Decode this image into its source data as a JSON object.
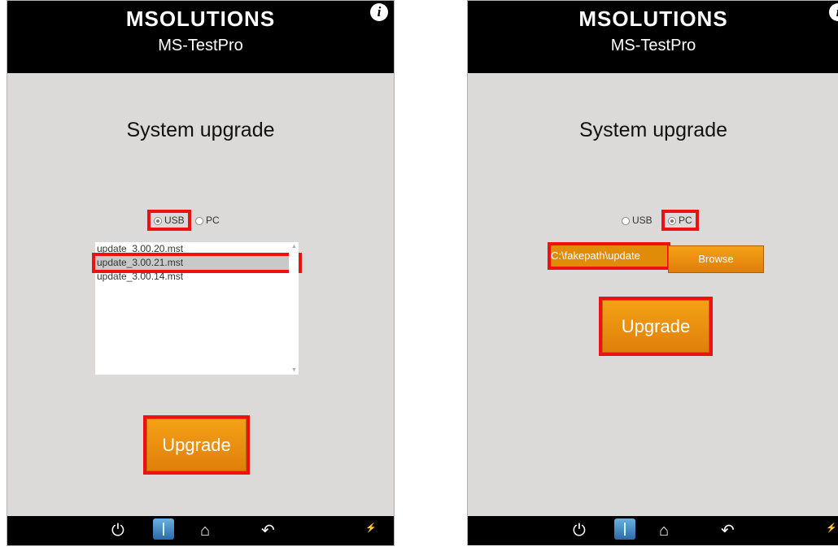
{
  "left": {
    "logo": "MSOLUTIONS",
    "app_title": "MS-TestPro",
    "info_icon": "i",
    "heading": "System upgrade",
    "radio_usb": "USB",
    "radio_pc": "PC",
    "selected_source": "USB",
    "files": [
      "update_3.00.20.mst",
      "update_3.00.21.mst",
      "update_3.00.14.mst"
    ],
    "selected_file": "update_3.00.21.mst",
    "upgrade_label": "Upgrade"
  },
  "right": {
    "logo": "MSOLUTIONS",
    "app_title": "MS-TestPro",
    "info_icon": "i",
    "heading": "System upgrade",
    "radio_usb": "USB",
    "radio_pc": "PC",
    "selected_source": "PC",
    "file_path": "C:\\fakepath\\update",
    "browse_label": "Browse",
    "upgrade_label": "Upgrade"
  },
  "footer": {
    "icons": [
      "power-icon",
      "usb-icon",
      "home-icon",
      "back-icon"
    ],
    "power_glyph": "⏻",
    "home_glyph": "⌂",
    "back_glyph": "↶"
  },
  "colors": {
    "accent_orange": "#f0900c",
    "highlight_red": "#ee1111",
    "panel_bg": "#dcd9d9"
  }
}
